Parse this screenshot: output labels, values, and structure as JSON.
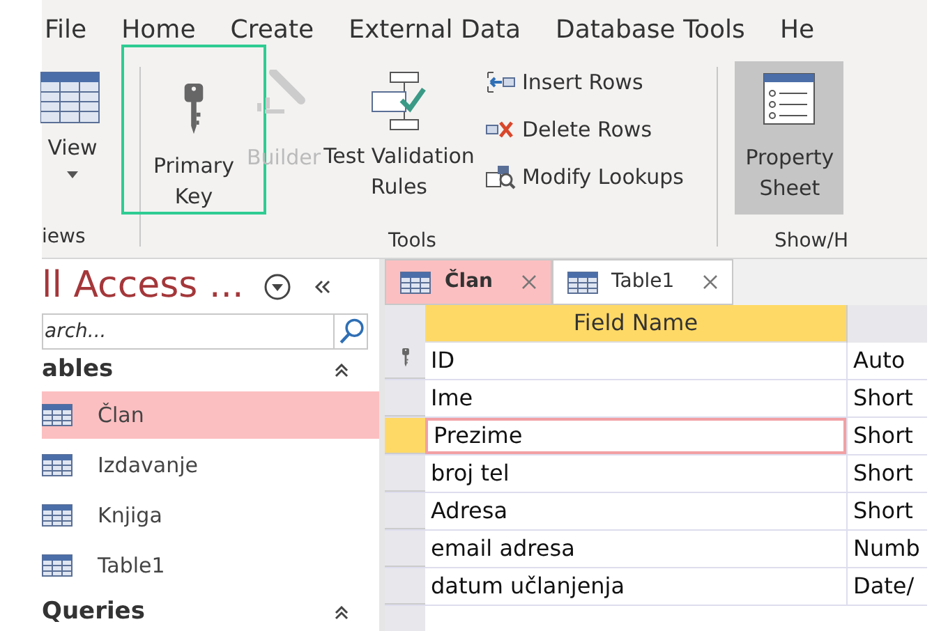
{
  "menu": [
    {
      "label": "File"
    },
    {
      "label": "Home"
    },
    {
      "label": "Create"
    },
    {
      "label": "External Data"
    },
    {
      "label": "Database Tools"
    },
    {
      "label": "He"
    }
  ],
  "ribbon": {
    "view_button": {
      "label": "View"
    },
    "views_group": "iews",
    "primary_key": {
      "line1": "Primary",
      "line2": "Key",
      "highlighted": true
    },
    "builder": {
      "label": "Builder",
      "disabled": true
    },
    "test_validation": {
      "line1": "Test Validation",
      "line2": "Rules"
    },
    "row_actions": [
      {
        "kind": "insert",
        "label": "Insert Rows"
      },
      {
        "kind": "delete",
        "label": "Delete Rows"
      },
      {
        "kind": "lookup",
        "label": "Modify Lookups"
      }
    ],
    "tools_group": "Tools",
    "property_sheet": {
      "line1": "Property",
      "line2": "Sheet",
      "selected": true
    },
    "show_group": "Show/H"
  },
  "nav": {
    "title": "ll Access ...",
    "search": {
      "placeholder": "arch..."
    },
    "sections": [
      {
        "label": "ables",
        "items": [
          {
            "label": "Član",
            "selected": true
          },
          {
            "label": "Izdavanje",
            "selected": false
          },
          {
            "label": "Knjiga",
            "selected": false
          },
          {
            "label": "Table1",
            "selected": false
          }
        ]
      },
      {
        "label": "Queries"
      }
    ]
  },
  "tabs": [
    {
      "label": "Član",
      "selected": true
    },
    {
      "label": "Table1",
      "selected": false
    }
  ],
  "table": {
    "columns": [
      "Field Name"
    ],
    "rows": [
      {
        "field": "ID",
        "type": "Auto",
        "primary_key": true,
        "selected": false
      },
      {
        "field": "Ime",
        "type": "Short",
        "primary_key": false,
        "selected": false
      },
      {
        "field": "Prezime",
        "type": "Short",
        "primary_key": false,
        "selected": true
      },
      {
        "field": "broj tel",
        "type": "Short",
        "primary_key": false,
        "selected": false
      },
      {
        "field": "Adresa",
        "type": "Short",
        "primary_key": false,
        "selected": false
      },
      {
        "field": "email adresa",
        "type": "Numb",
        "primary_key": false,
        "selected": false
      },
      {
        "field": "datum učlanjenja",
        "type": "Date/",
        "primary_key": false,
        "selected": false
      }
    ]
  }
}
